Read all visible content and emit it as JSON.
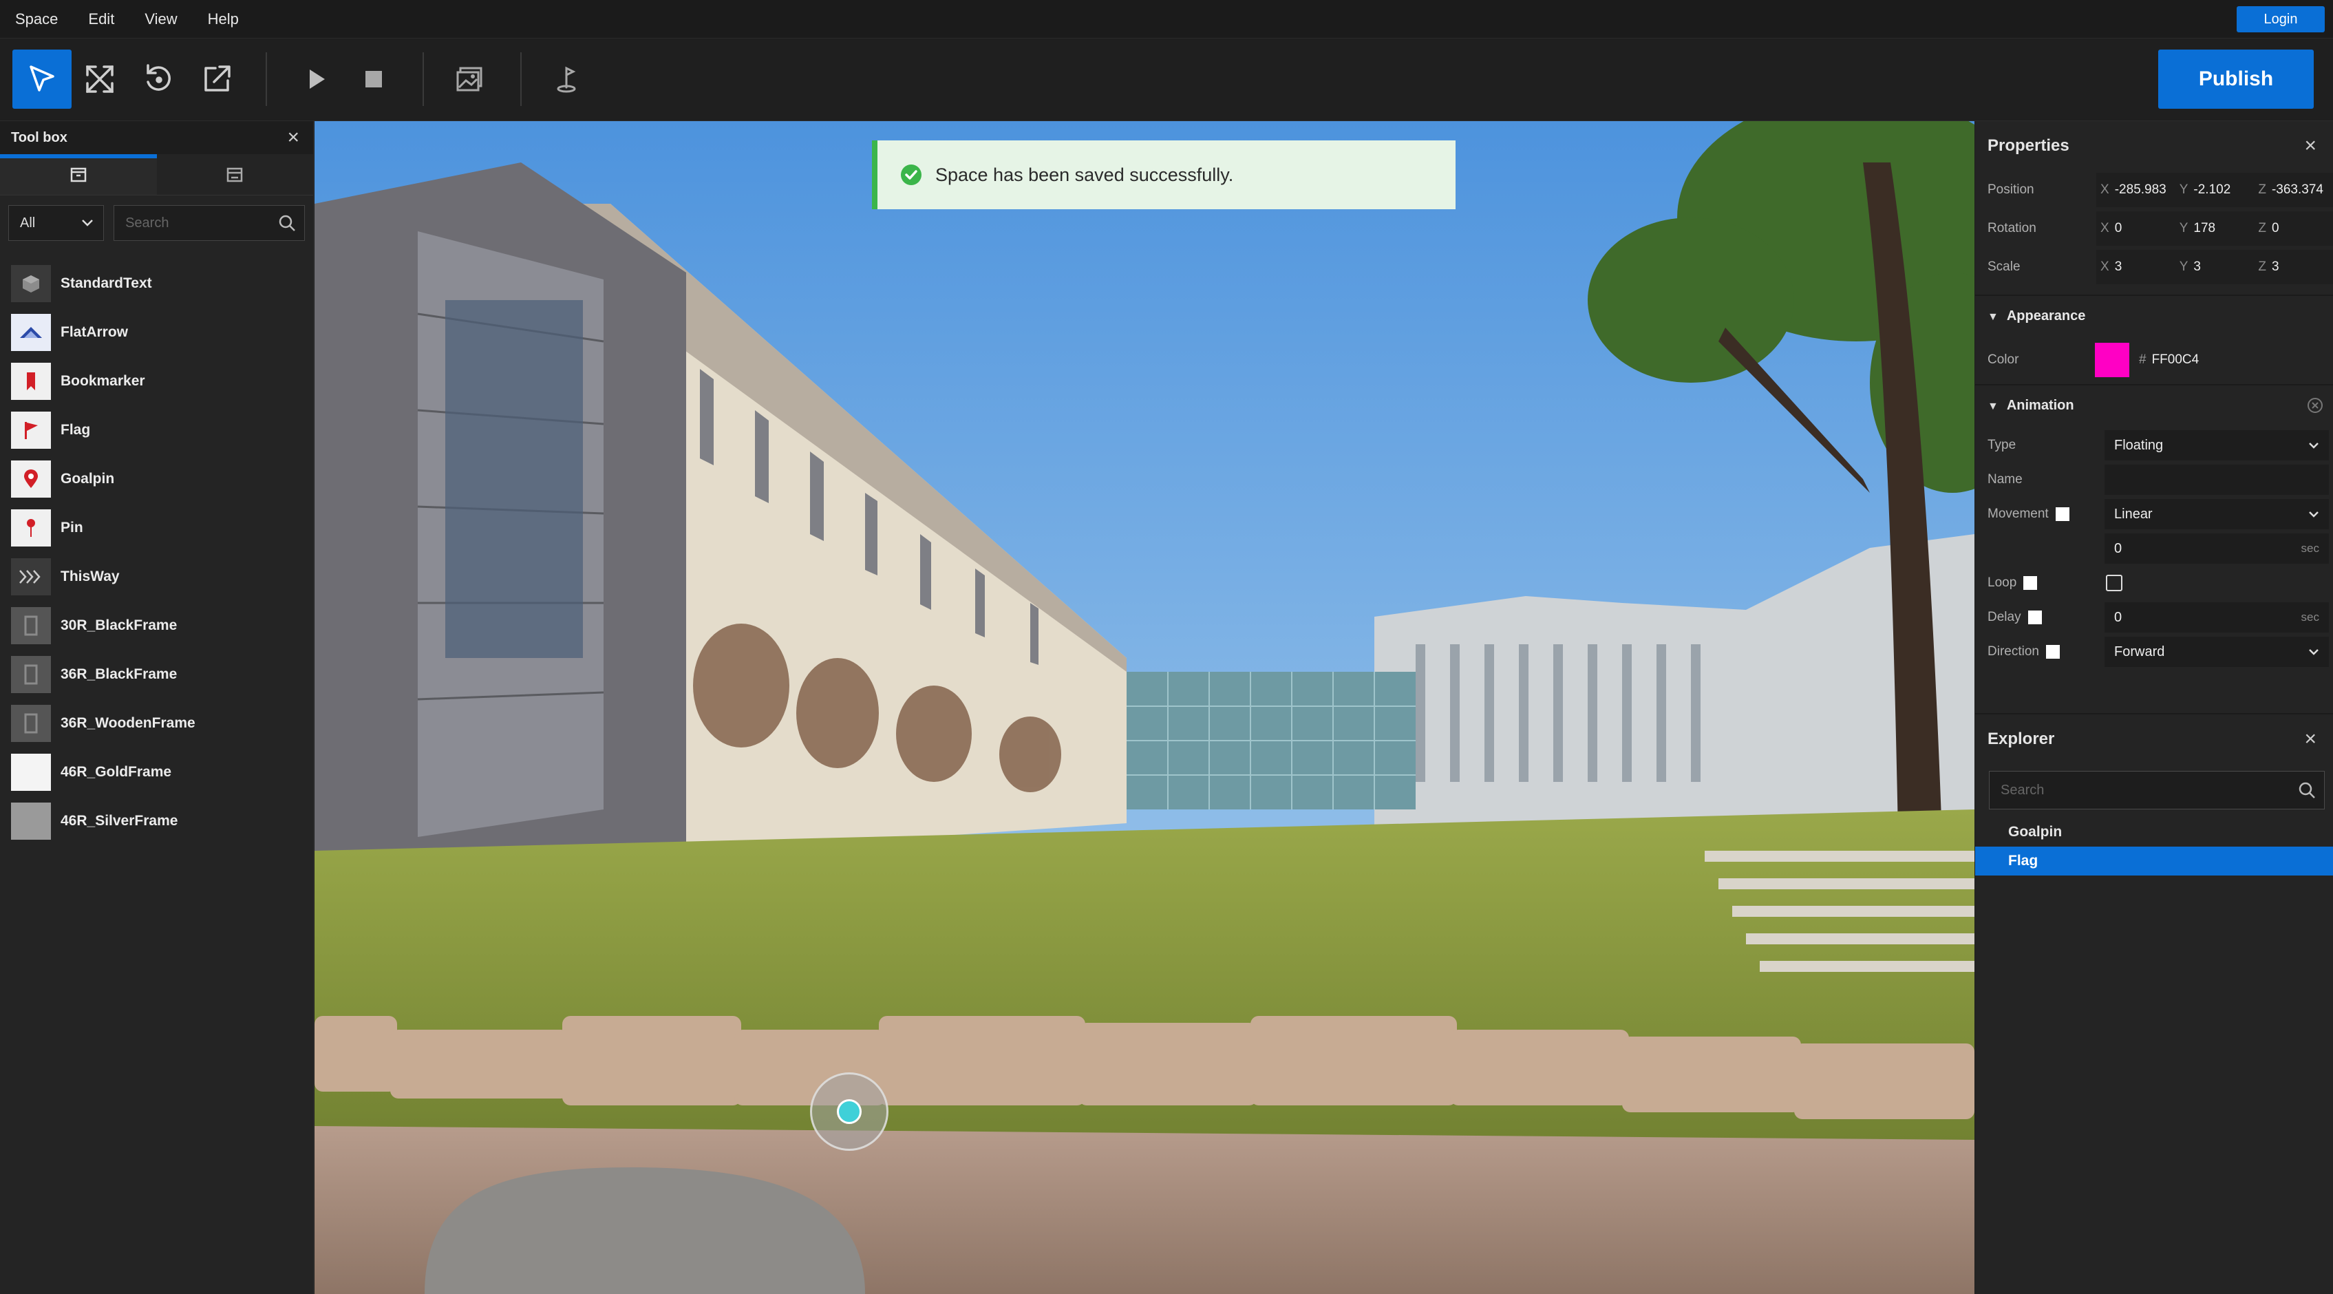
{
  "menu": [
    "Space",
    "Edit",
    "View",
    "Help"
  ],
  "login_label": "Login",
  "publish_label": "Publish",
  "toolbar_icons": [
    "select-icon",
    "scale-icon",
    "rotate-icon",
    "export-icon",
    "play-icon",
    "stop-icon",
    "image-icon",
    "hotspot-icon"
  ],
  "toolbox": {
    "title": "Tool box",
    "filter_value": "All",
    "search_placeholder": "Search",
    "items": [
      {
        "label": "StandardText",
        "icon": "cube-icon"
      },
      {
        "label": "FlatArrow",
        "icon": "arrow-icon"
      },
      {
        "label": "Bookmarker",
        "icon": "bookmark-icon"
      },
      {
        "label": "Flag",
        "icon": "flag-icon"
      },
      {
        "label": "Goalpin",
        "icon": "goalpin-icon"
      },
      {
        "label": "Pin",
        "icon": "pin-icon"
      },
      {
        "label": "ThisWay",
        "icon": "thisway-icon"
      },
      {
        "label": "30R_BlackFrame",
        "icon": "frame-icon"
      },
      {
        "label": "36R_BlackFrame",
        "icon": "frame-icon"
      },
      {
        "label": "36R_WoodenFrame",
        "icon": "frame-icon"
      },
      {
        "label": "46R_GoldFrame",
        "icon": "frame-icon"
      },
      {
        "label": "46R_SilverFrame",
        "icon": "frame-icon"
      }
    ]
  },
  "toast": {
    "message": "Space has been saved successfully."
  },
  "properties": {
    "title": "Properties",
    "position": {
      "label": "Position",
      "x": "-285.983",
      "y": "-2.102",
      "z": "-363.374"
    },
    "rotation": {
      "label": "Rotation",
      "x": "0",
      "y": "178",
      "z": "0"
    },
    "scale": {
      "label": "Scale",
      "x": "3",
      "y": "3",
      "z": "3"
    },
    "appearance": {
      "title": "Appearance",
      "color_label": "Color",
      "color_hex": "FF00C4",
      "color_value": "#ff00c4"
    },
    "animation": {
      "title": "Animation",
      "type_label": "Type",
      "type_value": "Floating",
      "name_label": "Name",
      "name_value": "",
      "movement_label": "Movement",
      "movement_value": "Linear",
      "duration_value": "0",
      "duration_unit": "sec",
      "loop_label": "Loop",
      "delay_label": "Delay",
      "delay_value": "0",
      "delay_unit": "sec",
      "direction_label": "Direction",
      "direction_value": "Forward"
    }
  },
  "explorer": {
    "title": "Explorer",
    "search_placeholder": "Search",
    "items": [
      {
        "label": "Goalpin",
        "selected": false
      },
      {
        "label": "Flag",
        "selected": true
      }
    ]
  },
  "colors": {
    "accent": "#0a6fd6",
    "success": "#3bb54a",
    "hotspot": "#3fd0d8"
  }
}
